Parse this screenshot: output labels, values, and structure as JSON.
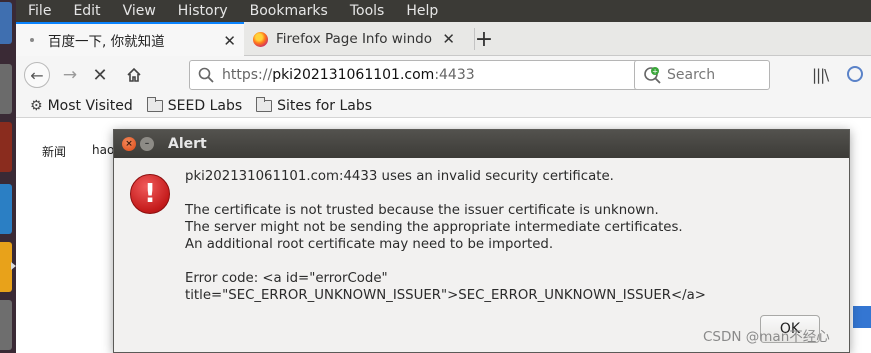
{
  "menu": {
    "items": [
      "File",
      "Edit",
      "View",
      "History",
      "Bookmarks",
      "Tools",
      "Help"
    ]
  },
  "tabs": [
    {
      "label": "百度一下, 你就知道",
      "active": true
    },
    {
      "label": "Firefox Page Info windo",
      "active": false
    }
  ],
  "navbar": {
    "url_scheme": "https://",
    "url_host": "pki202131061101.com",
    "url_port": ":4433",
    "search_placeholder": "Search"
  },
  "bookmarks": [
    {
      "label": "Most Visited",
      "icon": "gear-icon"
    },
    {
      "label": "SEED Labs",
      "icon": "folder-icon"
    },
    {
      "label": "Sites for Labs",
      "icon": "folder-icon"
    }
  ],
  "page": {
    "link_news": "新闻",
    "link_hao": "hao"
  },
  "dialog": {
    "title": "Alert",
    "icon": "!",
    "line1": "pki202131061101.com:4433 uses an invalid security certificate.",
    "line2": "The certificate is not trusted because the issuer certificate is unknown.",
    "line3": "The server might not be sending the appropriate intermediate certificates.",
    "line4": "An additional root certificate may need to be imported.",
    "line5": "Error code: <a id=\"errorCode\"",
    "line6": "title=\"SEC_ERROR_UNKNOWN_ISSUER\">SEC_ERROR_UNKNOWN_ISSUER</a>",
    "ok_label": "OK"
  },
  "watermark": "CSDN @man不经心",
  "colors": {
    "accent": "#0a84ff",
    "menubar": "#3b3a36",
    "dialog_title": "#3c3b37",
    "alert_red": "#c41b1b"
  }
}
